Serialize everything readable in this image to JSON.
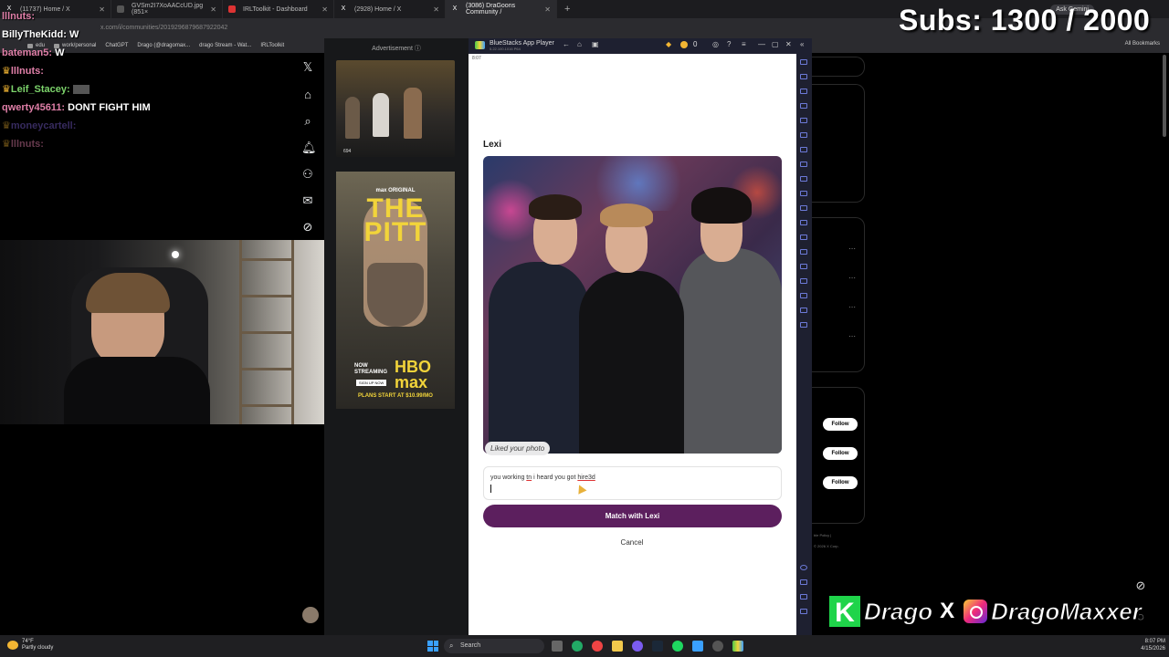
{
  "browser": {
    "tabs": [
      {
        "label": "(11737) Home / X",
        "active": false
      },
      {
        "label": "GVSm2I7XoAACcUD.jpg (851×",
        "active": false
      },
      {
        "label": "IRLToolkit - Dashboard",
        "active": false
      },
      {
        "label": "(2928) Home / X",
        "active": false
      },
      {
        "label": "(3086) DraGoons Community /",
        "active": true
      }
    ],
    "new_tab": "+",
    "url": "x.com/i/communities/2019296879687922042",
    "bookmarks": [
      "edu",
      "work/personal",
      "ChatGPT",
      "Drago (@dragomax...",
      "drago Stream - Wat...",
      "IRLToolkit"
    ],
    "all_bookmarks": "All Bookmarks",
    "ask_gemini": "Ask Gemini"
  },
  "overlay": {
    "subs_text": "Subs: 1300 / 2000",
    "brand_k": "K",
    "brand_drago": "Drago",
    "brand_x": "X",
    "brand_handle": "DragoMaxxer"
  },
  "chat": [
    {
      "user": "lllnuts:",
      "text": "",
      "style": "user1"
    },
    {
      "user": "BillyTheKidd:",
      "text": "W",
      "style": "user2"
    },
    {
      "user": "bateman5:",
      "text": "W",
      "style": "user1"
    },
    {
      "user": "lllnuts:",
      "text": "",
      "style": "user1"
    },
    {
      "user": "Leif_Stacey:",
      "text": "",
      "style": "user3"
    },
    {
      "user": "qwerty45611:",
      "text": "DONT FIGHT HIM",
      "style": "user1"
    },
    {
      "user": "moneycartell:",
      "text": "",
      "style": "user4"
    },
    {
      "user": "lllnuts:",
      "text": "",
      "style": "dim"
    }
  ],
  "ads": {
    "label": "Advertisement ⓘ",
    "thumb_count": "694",
    "pitt": {
      "origin": "max ORIGINAL",
      "title": "THE PITT",
      "now_streaming": "NOW STREAMING",
      "brand": "HBO max",
      "signup": "SIGN UP NOW",
      "plans": "PLANS START AT $10.99/MO"
    }
  },
  "bluestacks": {
    "title": "BlueStacks App Player",
    "version": "5.22.100.1016 P64",
    "coins": "0",
    "clock": "8:07"
  },
  "match_dialog": {
    "name": "Lexi",
    "liked_label": "Liked your photo",
    "comment_parts": [
      "you working ",
      "tn",
      " i heard you got ",
      "hire3d"
    ],
    "match_button": "Match with Lexi",
    "cancel_button": "Cancel"
  },
  "x_right": {
    "follow_label": "Follow",
    "footer1": "ble Policy  |",
    "footer2": "© 2026 X Corp."
  },
  "taskbar": {
    "temp": "74°F",
    "weather": "Partly cloudy",
    "search": "Search",
    "time": "8:07 PM",
    "date": "4/15/2026"
  },
  "colors": {
    "match_button": "#5c1f5e",
    "accent_green": "#1fd44a"
  }
}
